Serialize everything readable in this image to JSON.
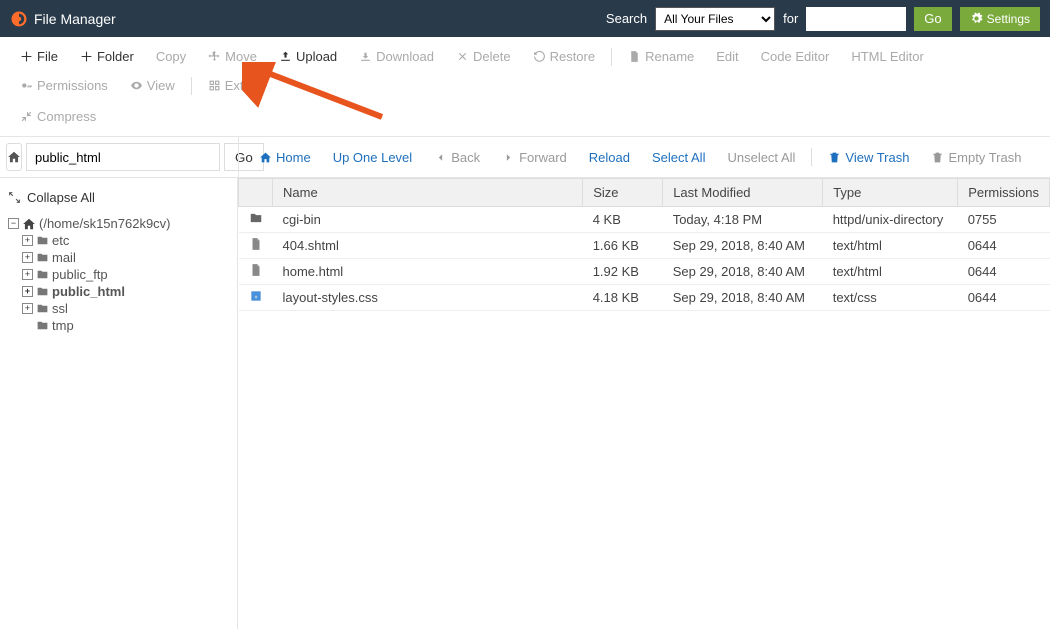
{
  "header": {
    "title": "File Manager",
    "search_label": "Search",
    "search_scope": "All Your Files",
    "for_label": "for",
    "search_value": "",
    "go_label": "Go",
    "settings_label": "Settings"
  },
  "toolbar": {
    "file": "File",
    "folder": "Folder",
    "copy": "Copy",
    "move": "Move",
    "upload": "Upload",
    "download": "Download",
    "delete": "Delete",
    "restore": "Restore",
    "rename": "Rename",
    "edit": "Edit",
    "code_editor": "Code Editor",
    "html_editor": "HTML Editor",
    "permissions": "Permissions",
    "view": "View",
    "extract": "Extract",
    "compress": "Compress"
  },
  "path": {
    "value": "public_html",
    "go": "Go"
  },
  "nav": {
    "home": "Home",
    "up_one": "Up One Level",
    "back": "Back",
    "forward": "Forward",
    "reload": "Reload",
    "select_all": "Select All",
    "unselect_all": "Unselect All",
    "view_trash": "View Trash",
    "empty_trash": "Empty Trash"
  },
  "sidebar": {
    "collapse_all": "Collapse All",
    "root_label": "(/home/sk15n762k9cv)",
    "items": [
      {
        "label": "etc",
        "bold": false
      },
      {
        "label": "mail",
        "bold": false
      },
      {
        "label": "public_ftp",
        "bold": false
      },
      {
        "label": "public_html",
        "bold": true
      },
      {
        "label": "ssl",
        "bold": false
      },
      {
        "label": "tmp",
        "bold": false
      }
    ]
  },
  "table": {
    "headers": {
      "name": "Name",
      "size": "Size",
      "last_modified": "Last Modified",
      "type": "Type",
      "permissions": "Permissions"
    },
    "rows": [
      {
        "icon": "folder",
        "name": "cgi-bin",
        "size": "4 KB",
        "modified": "Today, 4:18 PM",
        "type": "httpd/unix-directory",
        "perm": "0755"
      },
      {
        "icon": "file",
        "name": "404.shtml",
        "size": "1.66 KB",
        "modified": "Sep 29, 2018, 8:40 AM",
        "type": "text/html",
        "perm": "0644"
      },
      {
        "icon": "file",
        "name": "home.html",
        "size": "1.92 KB",
        "modified": "Sep 29, 2018, 8:40 AM",
        "type": "text/html",
        "perm": "0644"
      },
      {
        "icon": "css",
        "name": "layout-styles.css",
        "size": "4.18 KB",
        "modified": "Sep 29, 2018, 8:40 AM",
        "type": "text/css",
        "perm": "0644"
      }
    ]
  }
}
